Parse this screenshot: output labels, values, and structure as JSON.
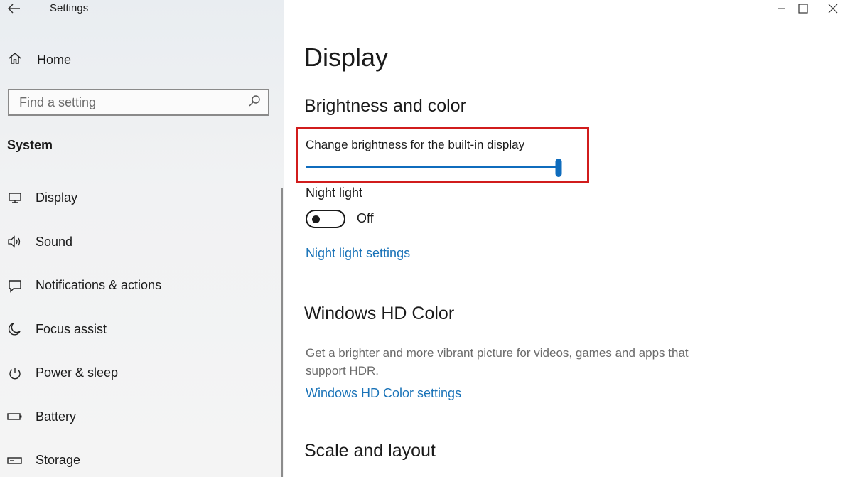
{
  "window": {
    "title": "Settings"
  },
  "sidebar": {
    "home_label": "Home",
    "search_placeholder": "Find a setting",
    "section_label": "System",
    "items": [
      {
        "label": "Display",
        "icon": "monitor-icon"
      },
      {
        "label": "Sound",
        "icon": "speaker-icon"
      },
      {
        "label": "Notifications & actions",
        "icon": "notification-icon"
      },
      {
        "label": "Focus assist",
        "icon": "moon-icon"
      },
      {
        "label": "Power & sleep",
        "icon": "power-icon"
      },
      {
        "label": "Battery",
        "icon": "battery-icon"
      },
      {
        "label": "Storage",
        "icon": "storage-icon"
      }
    ]
  },
  "main": {
    "title": "Display",
    "brightness": {
      "heading": "Brightness and color",
      "slider_label": "Change brightness for the built-in display",
      "slider_value_percent": 100
    },
    "night_light": {
      "label": "Night light",
      "state": "Off",
      "settings_link": "Night light settings"
    },
    "hd_color": {
      "heading": "Windows HD Color",
      "description": "Get a brighter and more vibrant picture for videos, games and apps that support HDR.",
      "settings_link": "Windows HD Color settings"
    },
    "scale": {
      "heading": "Scale and layout"
    }
  },
  "colors": {
    "accent": "#0f6cbd",
    "link": "#1a73b8",
    "highlight": "#d11c1c"
  }
}
